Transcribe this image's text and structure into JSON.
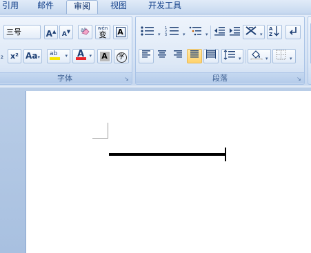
{
  "tabs": [
    {
      "label": "引用",
      "active": false
    },
    {
      "label": "邮件",
      "active": false
    },
    {
      "label": "审阅",
      "active": true
    },
    {
      "label": "视图",
      "active": false
    },
    {
      "label": "开发工具",
      "active": false
    }
  ],
  "font_group": {
    "label": "字体",
    "font_size": "三号",
    "grow_font": "A",
    "shrink_font": "A",
    "phonetic_top": "wén",
    "phonetic_char": "变",
    "char_border": "A",
    "subscript": "₂",
    "superscript": "x²",
    "change_case": "Aa",
    "highlight": "ab",
    "font_color": "A",
    "char_shading": "A",
    "enclose_char": "字",
    "font_color_swatch": "#e8252a",
    "highlight_swatch": "#f6e400"
  },
  "paragraph_group": {
    "label": "段落"
  },
  "launcher_glyph": "↘",
  "dropdown_glyph": "▾"
}
